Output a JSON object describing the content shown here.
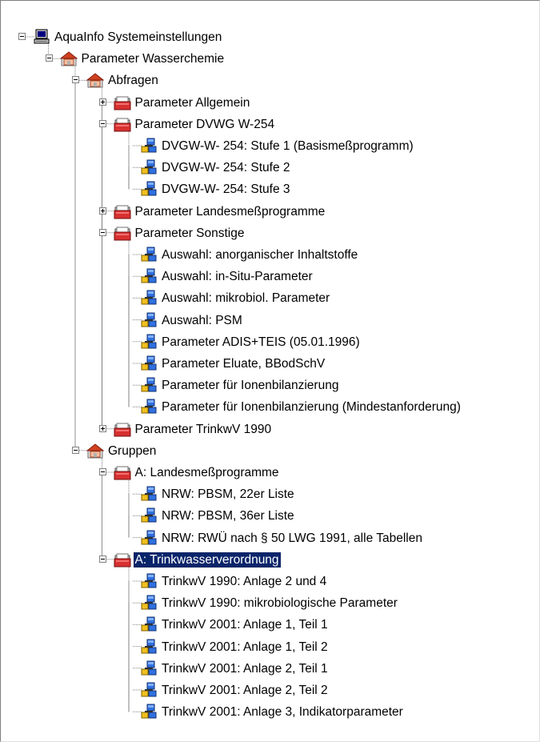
{
  "tree": {
    "nodes": [
      {
        "id": "root",
        "label": "AquaInfo Systemeinstellungen",
        "icon": "computer-icon",
        "level": 0,
        "expander": "minus"
      },
      {
        "id": "param-wasser",
        "label": "Parameter Wasserchemie",
        "icon": "folder-house-icon",
        "level": 1,
        "expander": "minus"
      },
      {
        "id": "abfragen",
        "label": "Abfragen",
        "icon": "folder-house-icon",
        "level": 2,
        "expander": "minus"
      },
      {
        "id": "p-allgemein",
        "label": "Parameter Allgemein",
        "icon": "folder-red-icon",
        "level": 3,
        "expander": "plus"
      },
      {
        "id": "p-dvwg",
        "label": "Parameter DVWG W-254",
        "icon": "folder-red-icon",
        "level": 3,
        "expander": "minus"
      },
      {
        "id": "dvgw1",
        "label": "DVGW-W- 254: Stufe 1 (Basismeßprogramm)",
        "icon": "network-item-icon",
        "level": 4,
        "expander": "none"
      },
      {
        "id": "dvgw2",
        "label": "DVGW-W- 254: Stufe 2",
        "icon": "network-item-icon",
        "level": 4,
        "expander": "none"
      },
      {
        "id": "dvgw3",
        "label": "DVGW-W- 254: Stufe 3",
        "icon": "network-item-icon",
        "level": 4,
        "expander": "none"
      },
      {
        "id": "p-landes",
        "label": "Parameter Landesmeßprogramme",
        "icon": "folder-red-icon",
        "level": 3,
        "expander": "plus"
      },
      {
        "id": "p-sonstige",
        "label": "Parameter Sonstige",
        "icon": "folder-red-icon",
        "level": 3,
        "expander": "minus"
      },
      {
        "id": "s1",
        "label": "Auswahl: anorganischer Inhaltstoffe",
        "icon": "network-item-icon",
        "level": 4,
        "expander": "none"
      },
      {
        "id": "s2",
        "label": "Auswahl: in-Situ-Parameter",
        "icon": "network-item-icon",
        "level": 4,
        "expander": "none"
      },
      {
        "id": "s3",
        "label": "Auswahl: mikrobiol. Parameter",
        "icon": "network-item-icon",
        "level": 4,
        "expander": "none"
      },
      {
        "id": "s4",
        "label": "Auswahl: PSM",
        "icon": "network-item-icon",
        "level": 4,
        "expander": "none"
      },
      {
        "id": "s5",
        "label": "Parameter ADIS+TEIS (05.01.1996)",
        "icon": "network-item-icon",
        "level": 4,
        "expander": "none"
      },
      {
        "id": "s6",
        "label": "Parameter Eluate, BBodSchV",
        "icon": "network-item-icon",
        "level": 4,
        "expander": "none"
      },
      {
        "id": "s7",
        "label": "Parameter für Ionenbilanzierung",
        "icon": "network-item-icon",
        "level": 4,
        "expander": "none"
      },
      {
        "id": "s8",
        "label": "Parameter für Ionenbilanzierung (Mindestanforderung)",
        "icon": "network-item-icon",
        "level": 4,
        "expander": "none"
      },
      {
        "id": "p-trinkwv",
        "label": "Parameter TrinkwV 1990",
        "icon": "folder-red-icon",
        "level": 3,
        "expander": "plus"
      },
      {
        "id": "gruppen",
        "label": "Gruppen",
        "icon": "folder-house-icon",
        "level": 2,
        "expander": "minus"
      },
      {
        "id": "g-landes",
        "label": "A: Landesmeßprogramme",
        "icon": "folder-red-icon",
        "level": 3,
        "expander": "minus"
      },
      {
        "id": "n1",
        "label": "NRW: PBSM, 22er Liste",
        "icon": "network-item-icon",
        "level": 4,
        "expander": "none"
      },
      {
        "id": "n2",
        "label": "NRW: PBSM, 36er Liste",
        "icon": "network-item-icon",
        "level": 4,
        "expander": "none"
      },
      {
        "id": "n3",
        "label": "NRW: RWÜ nach § 50 LWG 1991, alle Tabellen",
        "icon": "network-item-icon",
        "level": 4,
        "expander": "none"
      },
      {
        "id": "g-trink",
        "label": "A: Trinkwasserverordnung",
        "icon": "folder-red-icon",
        "level": 3,
        "expander": "minus",
        "selected": true
      },
      {
        "id": "t1",
        "label": "TrinkwV 1990: Anlage 2 und 4",
        "icon": "network-item-icon",
        "level": 4,
        "expander": "none"
      },
      {
        "id": "t2",
        "label": "TrinkwV 1990: mikrobiologische Parameter",
        "icon": "network-item-icon",
        "level": 4,
        "expander": "none"
      },
      {
        "id": "t3",
        "label": "TrinkwV 2001: Anlage 1, Teil 1",
        "icon": "network-item-icon",
        "level": 4,
        "expander": "none"
      },
      {
        "id": "t4",
        "label": "TrinkwV 2001: Anlage 1, Teil 2",
        "icon": "network-item-icon",
        "level": 4,
        "expander": "none"
      },
      {
        "id": "t5",
        "label": "TrinkwV 2001: Anlage 2, Teil 1",
        "icon": "network-item-icon",
        "level": 4,
        "expander": "none"
      },
      {
        "id": "t6",
        "label": "TrinkwV 2001: Anlage 2, Teil 2",
        "icon": "network-item-icon",
        "level": 4,
        "expander": "none"
      },
      {
        "id": "t7",
        "label": "TrinkwV 2001: Anlage 3, Indikatorparameter",
        "icon": "network-item-icon",
        "level": 4,
        "expander": "none"
      }
    ]
  },
  "colors": {
    "selection_bg": "#0a246a",
    "selection_fg": "#ffffff",
    "line": "#808080"
  }
}
